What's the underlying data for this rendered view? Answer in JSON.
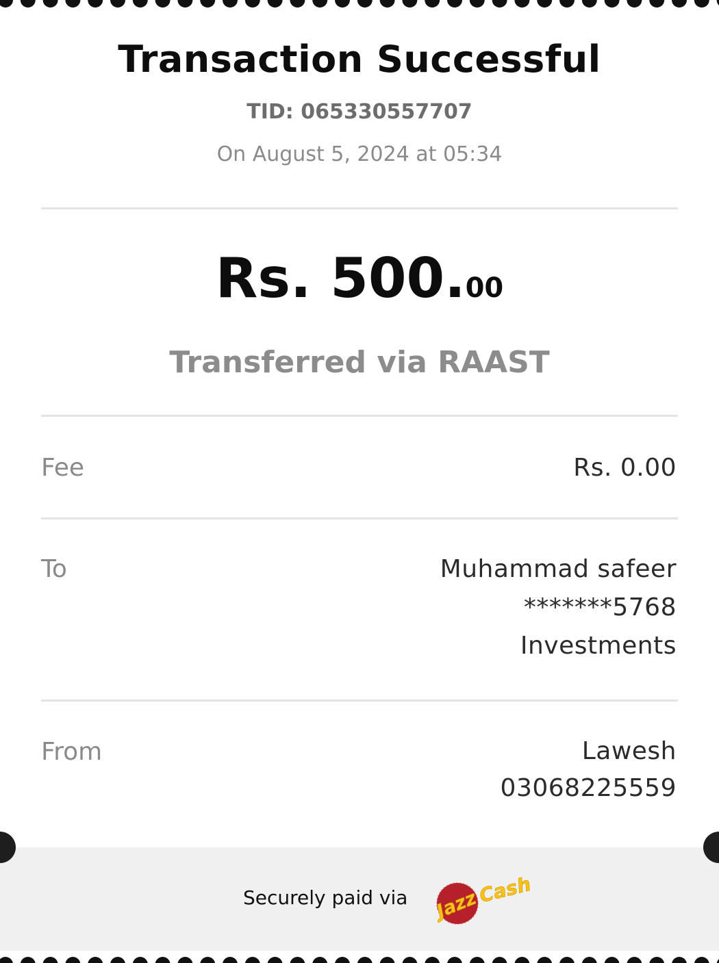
{
  "receipt": {
    "title": "Transaction Successful",
    "tid": "TID: 065330557707",
    "date": "On August 5, 2024 at 05:34",
    "amount_main": "Rs. 500.",
    "amount_cents": "00",
    "method": "Transferred via RAAST"
  },
  "details": {
    "fee_label": "Fee",
    "fee_value": "Rs. 0.00",
    "to_label": "To",
    "to_name": "Muhammad safeer",
    "to_account": "*******5768",
    "to_bank": "Investments",
    "from_label": "From",
    "from_name": "Lawesh",
    "from_number": "03068225559"
  },
  "footer": {
    "secure_text": "Securely paid via",
    "logo_text_left": "Jazz",
    "logo_text_right": "Cash",
    "logo_icon": "jazzcash-logo"
  },
  "colors": {
    "title": "#0d0d0d",
    "muted": "#8a8a8a",
    "divider": "#e4e4e4",
    "footer_bg": "#f0f0f0",
    "scallop": "#111111",
    "logo_red": "#b5202a",
    "logo_yellow": "#f6c21a"
  }
}
